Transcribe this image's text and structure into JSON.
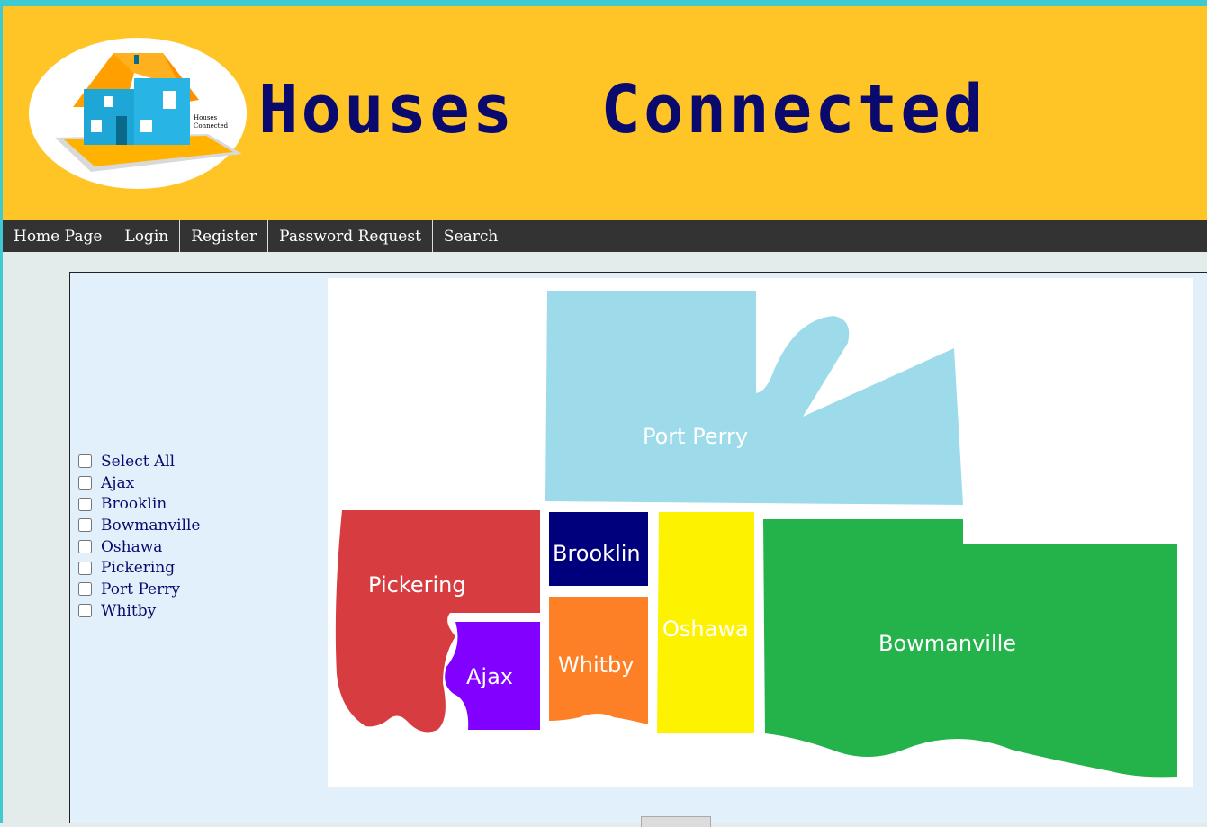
{
  "site": {
    "title": "Houses  Connected",
    "logo_text_line1": "Houses",
    "logo_text_line2": "Connected"
  },
  "nav": {
    "items": [
      "Home Page",
      "Login",
      "Register",
      "Password Request",
      "Search"
    ]
  },
  "filters": {
    "select_all": "Select All",
    "areas": [
      "Ajax",
      "Brooklin",
      "Bowmanville",
      "Oshawa",
      "Pickering",
      "Port Perry",
      "Whitby"
    ]
  },
  "map": {
    "labels": {
      "port_perry": "Port Perry",
      "pickering": "Pickering",
      "ajax": "Ajax",
      "brooklin": "Brooklin",
      "whitby": "Whitby",
      "oshawa": "Oshawa",
      "bowmanville": "Bowmanville"
    },
    "colors": {
      "port_perry": "#9ddbea",
      "pickering": "#d63c40",
      "ajax": "#8200ff",
      "brooklin": "#00007c",
      "whitby": "#fe8026",
      "oshawa": "#fdf200",
      "bowmanville": "#24b24a"
    }
  },
  "theme": {
    "accent_bar": "#3ecad0",
    "header_bg": "#ffc527",
    "title_color": "#0a0a6e",
    "nav_bg": "#333333",
    "content_bg": "#e2f0fb"
  }
}
